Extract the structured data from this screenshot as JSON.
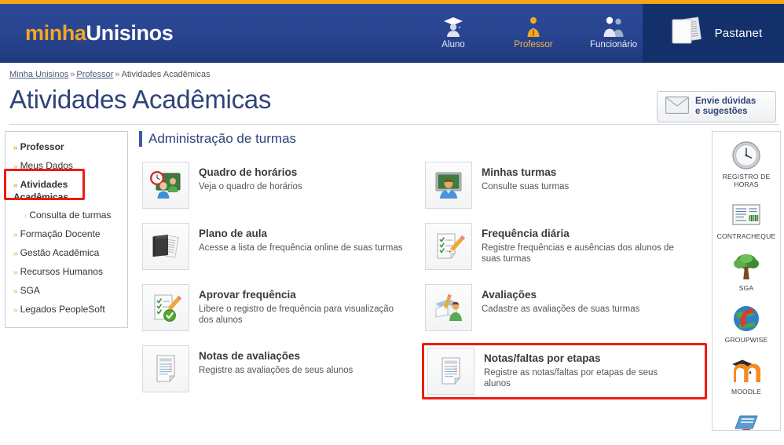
{
  "header": {
    "logo_part1": "minha",
    "logo_part2": "Unisinos",
    "personas": [
      {
        "label": "Aluno",
        "icon": "graduate-icon",
        "active": false
      },
      {
        "label": "Professor",
        "icon": "teacher-icon",
        "active": true
      },
      {
        "label": "Funcionário",
        "icon": "staff-icon",
        "active": false
      }
    ],
    "pastanet_label": "Pastanet",
    "pastanet_icon": "folder-pages-icon"
  },
  "breadcrumb": {
    "items": [
      "Minha Unisinos",
      "Professor",
      "Atividades Acadêmicas"
    ],
    "separator": "»"
  },
  "page_title": "Atividades Acadêmicas",
  "help_box": {
    "line1": "Envie dúvidas",
    "line2": "e sugestões",
    "icon": "envelope-icon"
  },
  "sidebar": {
    "items": [
      {
        "label": "Professor",
        "bold": true,
        "sub": false
      },
      {
        "label": "Meus Dados",
        "bold": false,
        "sub": false
      },
      {
        "label": "Atividades Acadêmicas",
        "bold": true,
        "sub": false,
        "highlighted": true
      },
      {
        "label": "Consulta de turmas",
        "bold": false,
        "sub": true
      },
      {
        "label": "Formação Docente",
        "bold": false,
        "sub": false
      },
      {
        "label": "Gestão Acadêmica",
        "bold": false,
        "sub": false
      },
      {
        "label": "Recursos Humanos",
        "bold": false,
        "sub": false
      },
      {
        "label": "SGA",
        "bold": false,
        "sub": false
      },
      {
        "label": "Legados PeopleSoft",
        "bold": false,
        "sub": false
      }
    ]
  },
  "main": {
    "section_title": "Administração de turmas",
    "cards": [
      {
        "title": "Quadro de horários",
        "desc": "Veja o quadro de horários",
        "icon": "clock-people-icon",
        "highlighted": false
      },
      {
        "title": "Minhas turmas",
        "desc": "Consulte suas turmas",
        "icon": "chalkboard-person-icon",
        "highlighted": false
      },
      {
        "title": "Plano de aula",
        "desc": "Acesse a lista de frequência online de suas turmas",
        "icon": "notebook-icon",
        "highlighted": false
      },
      {
        "title": "Frequência diária",
        "desc": "Registre frequências e ausências dos alunos de suas turmas",
        "icon": "checklist-pencil-icon",
        "highlighted": false
      },
      {
        "title": "Aprovar frequência",
        "desc": "Libere o registro de frequência para visualização dos alunos",
        "icon": "checklist-approved-icon",
        "highlighted": false
      },
      {
        "title": "Avaliações",
        "desc": "Cadastre as avaliações de suas turmas",
        "icon": "exam-person-icon",
        "highlighted": false
      },
      {
        "title": "Notas de avaliações",
        "desc": "Registre as avaliações de seus alunos",
        "icon": "document-lines-icon",
        "highlighted": false
      },
      {
        "title": "Notas/faltas por etapas",
        "desc": "Registre as notas/faltas por etapas de seus alunos",
        "icon": "document-lines-icon",
        "highlighted": true
      }
    ]
  },
  "right_rail": {
    "items": [
      {
        "label": "REGISTRO DE HORAS",
        "icon": "clock-icon"
      },
      {
        "label": "CONTRACHEQUE",
        "icon": "payslip-barcode-icon"
      },
      {
        "label": "SGA",
        "icon": "tree-icon"
      },
      {
        "label": "GROUPWISE",
        "icon": "globe-arrow-icon"
      },
      {
        "label": "MOODLE",
        "icon": "moodle-icon"
      },
      {
        "label": "",
        "icon": "blue-book-icon"
      }
    ]
  },
  "colors": {
    "header_blue": "#2b4896",
    "pastanet_blue": "#14306b",
    "accent_orange": "#f7a513",
    "title_navy": "#2e4479",
    "highlight_red": "#ee1c11"
  }
}
